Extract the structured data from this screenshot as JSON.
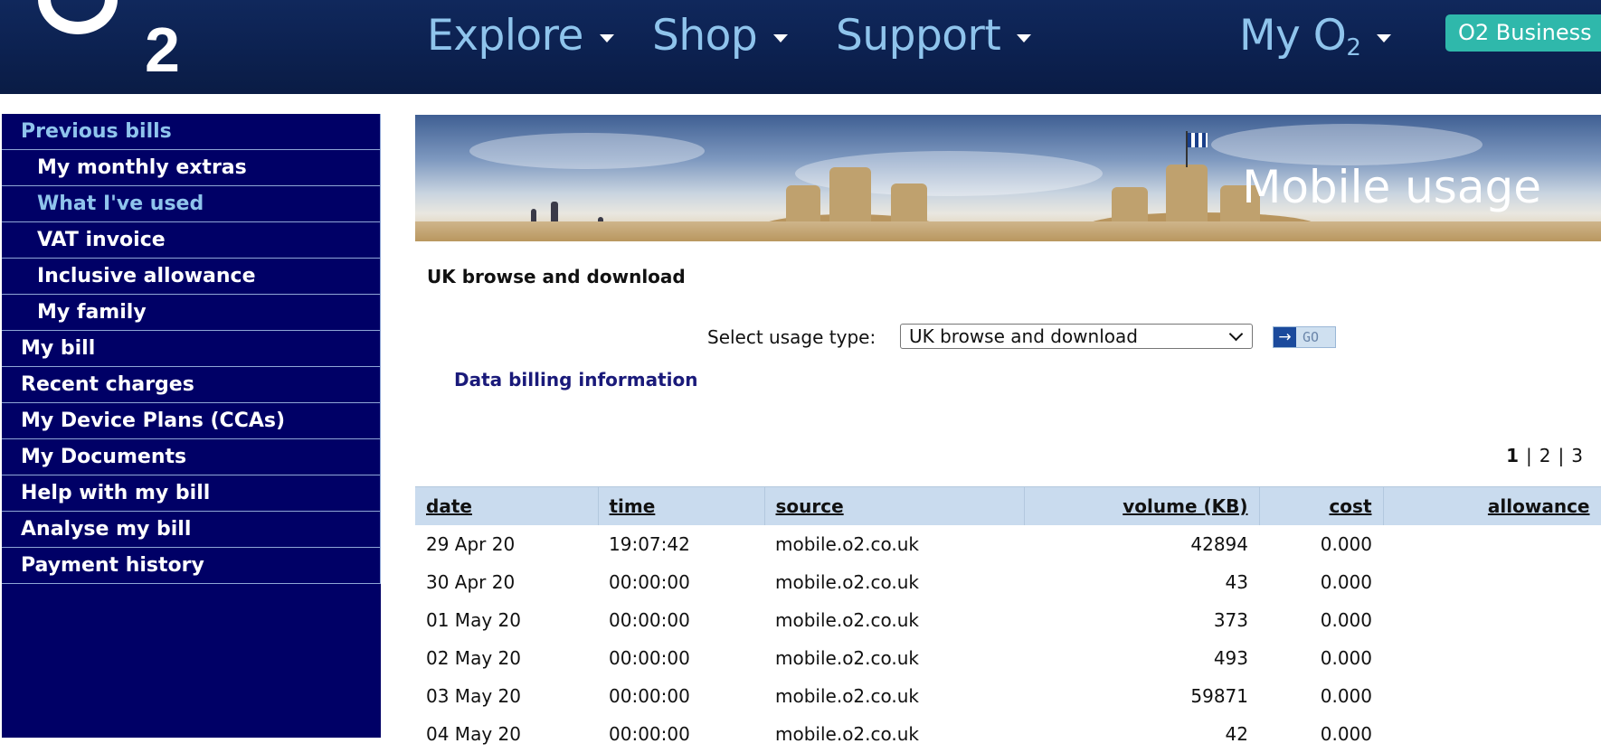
{
  "brand": {
    "logo_letter": "O",
    "logo_sub": "2"
  },
  "nav": {
    "items": [
      {
        "label": "Explore"
      },
      {
        "label": "Shop"
      },
      {
        "label": "Support"
      },
      {
        "label": "My O",
        "sub": "2"
      }
    ],
    "business_button": "O2 Business"
  },
  "sidebar": {
    "items": [
      {
        "label": "Previous bills"
      },
      {
        "label": "My monthly extras"
      },
      {
        "label": "What I've used"
      },
      {
        "label": "VAT invoice"
      },
      {
        "label": "Inclusive allowance"
      },
      {
        "label": "My family"
      },
      {
        "label": "My bill"
      },
      {
        "label": "Recent charges"
      },
      {
        "label": "My Device Plans (CCAs)"
      },
      {
        "label": "My Documents"
      },
      {
        "label": "Help with my bill"
      },
      {
        "label": "Analyse my bill"
      },
      {
        "label": "Payment history"
      }
    ]
  },
  "banner": {
    "title": "Mobile usage"
  },
  "main": {
    "section_title": "UK browse and download",
    "select_label": "Select usage type:",
    "select_value": "UK browse and download",
    "go_label": "GO",
    "billing_link": "Data billing information",
    "pager": {
      "pages": [
        "1",
        "2",
        "3"
      ],
      "separator": "|",
      "current": "1"
    }
  },
  "table": {
    "headers": {
      "date": "date",
      "time": "time",
      "source": "source",
      "volume": "volume (KB)",
      "cost": "cost",
      "allowance": "allowance"
    },
    "rows": [
      {
        "date": "29 Apr 20",
        "time": "19:07:42",
        "source": "mobile.o2.co.uk",
        "volume": "42894",
        "cost": "0.000",
        "allowance": ""
      },
      {
        "date": "30 Apr 20",
        "time": "00:00:00",
        "source": "mobile.o2.co.uk",
        "volume": "43",
        "cost": "0.000",
        "allowance": ""
      },
      {
        "date": "01 May 20",
        "time": "00:00:00",
        "source": "mobile.o2.co.uk",
        "volume": "373",
        "cost": "0.000",
        "allowance": ""
      },
      {
        "date": "02 May 20",
        "time": "00:00:00",
        "source": "mobile.o2.co.uk",
        "volume": "493",
        "cost": "0.000",
        "allowance": ""
      },
      {
        "date": "03 May 20",
        "time": "00:00:00",
        "source": "mobile.o2.co.uk",
        "volume": "59871",
        "cost": "0.000",
        "allowance": ""
      },
      {
        "date": "04 May 20",
        "time": "00:00:00",
        "source": "mobile.o2.co.uk",
        "volume": "42",
        "cost": "0.000",
        "allowance": ""
      }
    ]
  },
  "colors": {
    "topbar": "#0c2150",
    "nav_text": "#8fc4ec",
    "business_button": "#2fb8ab",
    "sidebar": "#000066",
    "sidebar_active": "#8fc4ec",
    "table_header": "#c9dbee",
    "link": "#1a1a7a"
  },
  "icons": {
    "nav_dropdown": "chevron-down-icon",
    "select_dropdown": "chevron-down-icon",
    "go_arrow": "arrow-right-icon"
  }
}
